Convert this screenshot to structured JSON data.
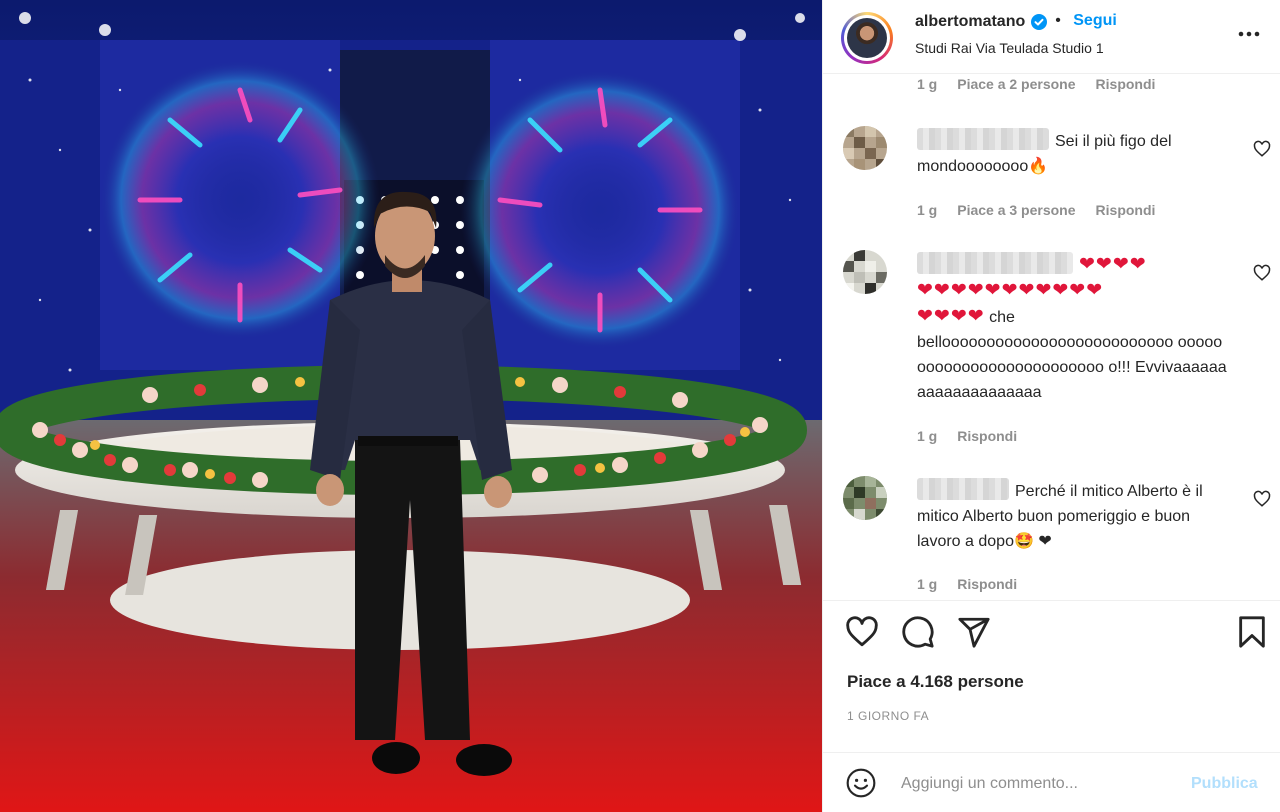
{
  "post": {
    "username": "albertomatano",
    "separator": "•",
    "follow_label": "Segui",
    "location": "Studi Rai Via Teulada Studio 1",
    "more_icon": "more-horizontal-icon",
    "verified_icon": "verified-badge-icon"
  },
  "comments": [
    {
      "text": "",
      "meta": {
        "age": "1 g",
        "likes": "Piace a 2 persone",
        "reply": "Rispondi"
      },
      "partial": true
    },
    {
      "text": "Sei il più figo del mondoooooooo🔥",
      "meta": {
        "age": "1 g",
        "likes": "Piace a 3 persone",
        "reply": "Rispondi"
      }
    },
    {
      "hearts_line1": "❤❤❤❤",
      "hearts_line2": "❤❤❤❤❤❤❤❤❤❤❤",
      "hearts_line3": "❤❤❤❤",
      "text_after_hearts": "che",
      "text_rest": "belloooooooooooooooooooooooooo oooooooooooooooooooooooooo o!!! Evvivaaaaaaaaaaaaaaaaaaaa",
      "meta": {
        "age": "1 g",
        "reply": "Rispondi"
      }
    },
    {
      "text": "Perché il mitico Alberto è il mitico Alberto buon pomeriggio e buon lavoro a dopo🤩 ❤",
      "meta": {
        "age": "1 g",
        "reply": "Rispondi"
      }
    }
  ],
  "actions": {
    "like_icon": "heart-icon",
    "comment_icon": "comment-icon",
    "share_icon": "send-icon",
    "save_icon": "bookmark-icon"
  },
  "likes_text": "Piace a 4.168 persone",
  "time_ago": "1 GIORNO FA",
  "add_comment": {
    "placeholder": "Aggiungi un commento...",
    "publish_label": "Pubblica",
    "emoji_icon": "emoji-icon"
  },
  "colors": {
    "link_blue": "#0095f6",
    "publish_disabled": "#b2dffc",
    "muted_text": "#8e8e8e",
    "heart_red": "#e0163a"
  }
}
